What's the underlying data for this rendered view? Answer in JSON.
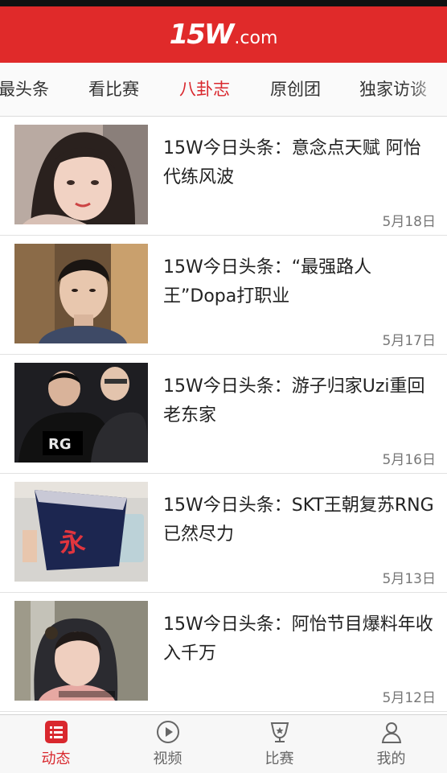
{
  "header": {
    "logo_main": "15W",
    "logo_suffix": ".com"
  },
  "tabs": [
    {
      "label": "最头条",
      "active": false
    },
    {
      "label": "看比赛",
      "active": false
    },
    {
      "label": "八卦志",
      "active": true
    },
    {
      "label": "原创团",
      "active": false
    },
    {
      "label": "独家访谈",
      "active": false
    }
  ],
  "articles": [
    {
      "title": "15W今日头条：意念点天赋 阿怡代练风波",
      "date": "5月18日"
    },
    {
      "title": "15W今日头条：“最强路人王”Dopa打职业",
      "date": "5月17日"
    },
    {
      "title": "15W今日头条：游子归家Uzi重回老东家",
      "date": "5月16日"
    },
    {
      "title": "15W今日头条：SKT王朝复苏RNG已然尽力",
      "date": "5月13日"
    },
    {
      "title": "15W今日头条：阿怡节目爆料年收入千万",
      "date": "5月12日"
    }
  ],
  "bottom_nav": [
    {
      "label": "动态",
      "icon": "list-icon",
      "active": true
    },
    {
      "label": "视频",
      "icon": "play-icon",
      "active": false
    },
    {
      "label": "比赛",
      "icon": "trophy-icon",
      "active": false
    },
    {
      "label": "我的",
      "icon": "person-icon",
      "active": false
    }
  ],
  "colors": {
    "brand_red": "#e02a2a",
    "active_red": "#d9282e"
  }
}
